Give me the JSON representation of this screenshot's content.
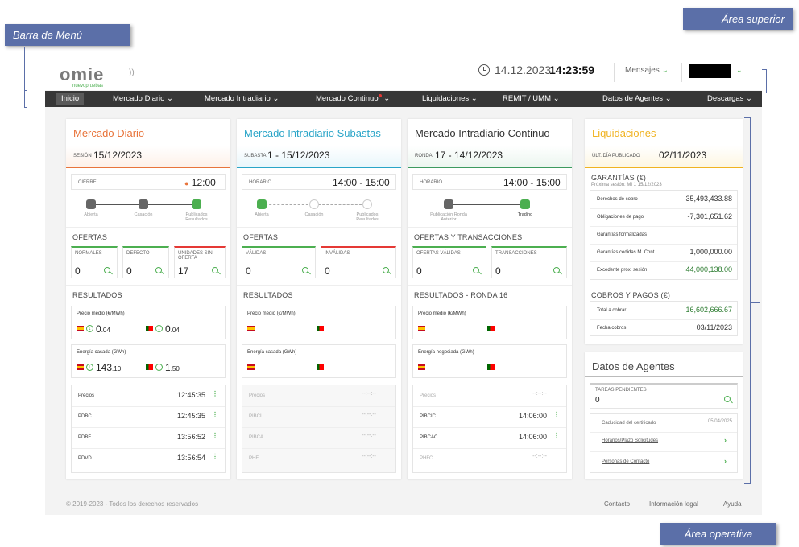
{
  "annotations": {
    "menu_bar": "Barra de Menú",
    "top_area": "Área superior",
    "operative_area": "Área operativa"
  },
  "header": {
    "logo_main": "omie",
    "logo_sub": "nuevopruebas",
    "date": "14.12.2023",
    "time": "14:23:59",
    "messages_label": "Mensajes",
    "user_name": ""
  },
  "nav": [
    "Inicio",
    "Mercado Diario",
    "Mercado Intradiario",
    "Mercado Continuo",
    "Liquidaciones",
    "REMIT / UMM",
    "Datos de Agentes",
    "Descargas"
  ],
  "diario": {
    "title": "Mercado Diario",
    "session_label": "SESIÓN",
    "session_value": "15/12/2023",
    "close_label": "CIERRE",
    "close_time": "12:00",
    "steps": [
      "Abierta",
      "Casación",
      "Publicados Resultados"
    ],
    "offers_title": "OFERTAS",
    "offers": [
      {
        "label": "NORMALES",
        "value": "0"
      },
      {
        "label": "DEFECTO",
        "value": "0"
      },
      {
        "label": "UNIDADES SIN OFERTA",
        "value": "17"
      }
    ],
    "results_title": "RESULTADOS",
    "price_label": "Precio medio (€/MWh)",
    "price_es_int": "0",
    "price_es_dec": ".04",
    "price_pt_int": "0",
    "price_pt_dec": ".04",
    "energy_label": "Energía casada (GWh)",
    "energy_es_int": "143",
    "energy_es_dec": ".10",
    "energy_pt_int": "1",
    "energy_pt_dec": ".50",
    "rows": [
      {
        "label": "Precios",
        "value": "12:45:35"
      },
      {
        "label": "PDBC",
        "value": "12:45:35"
      },
      {
        "label": "PDBF",
        "value": "13:56:52"
      },
      {
        "label": "PDVD",
        "value": "13:56:54"
      }
    ]
  },
  "subastas": {
    "title": "Mercado Intradiario Subastas",
    "session_label": "SUBASTA",
    "session_value": "1 - 15/12/2023",
    "schedule_label": "HORARIO",
    "schedule_value": "14:00 - 15:00",
    "steps": [
      "Abierta",
      "Casación",
      "Publicados Resultados"
    ],
    "offers_title": "OFERTAS",
    "offers": [
      {
        "label": "VÁLIDAS",
        "value": "0"
      },
      {
        "label": "INVÁLIDAS",
        "value": "0"
      }
    ],
    "results_title": "RESULTADOS",
    "price_label": "Precio medio (€/MWh)",
    "energy_label": "Energía casada (GWh)",
    "rows": [
      {
        "label": "Precios",
        "value": "--:--:--"
      },
      {
        "label": "PIBCI",
        "value": "--:--:--"
      },
      {
        "label": "PIBCA",
        "value": "--:--:--"
      },
      {
        "label": "PHF",
        "value": "--:--:--"
      }
    ]
  },
  "continuo": {
    "title": "Mercado Intradiario Continuo",
    "session_label": "RONDA",
    "session_value": "17 - 14/12/2023",
    "schedule_label": "HORARIO",
    "schedule_value": "14:00 - 15:00",
    "steps": [
      "Publicación Ronda Anterior",
      "Trading"
    ],
    "offers_title": "OFERTAS Y TRANSACCIONES",
    "offers": [
      {
        "label": "OFERTAS VÁLIDAS",
        "value": "0"
      },
      {
        "label": "TRANSACCIONES",
        "value": "0"
      }
    ],
    "results_title": "RESULTADOS - RONDA 16",
    "price_label": "Precio medio (€/MWh)",
    "energy_label": "Energía negociada (GWh)",
    "rows": [
      {
        "label": "Precios",
        "value": "--:--:--"
      },
      {
        "label": "PIBCIC",
        "value": "14:06:00"
      },
      {
        "label": "PIBCAC",
        "value": "14:06:00"
      },
      {
        "label": "PHFC",
        "value": "--:--:--"
      }
    ]
  },
  "liquidaciones": {
    "title": "Liquidaciones",
    "session_label": "ÚLT. DÍA PUBLICADO",
    "session_value": "02/11/2023",
    "guarantees_title": "GARANTÍAS (€)",
    "next_session": "Próxima sesión: MI 1 15/12/2023",
    "guarantees": [
      {
        "label": "Derechos de cobro",
        "value": "35,493,433.88"
      },
      {
        "label": "Obligaciones de pago",
        "value": "-7,301,651.62"
      },
      {
        "label": "Garantías formalizadas",
        "value": ""
      },
      {
        "label": "Garantías cedidas M. Cont",
        "value": "1,000,000.00"
      },
      {
        "label": "Excedente próx. sesión",
        "value": "44,000,138.00"
      }
    ],
    "payments_title": "COBROS Y PAGOS (€)",
    "payments": [
      {
        "label": "Total a cobrar",
        "value": "16,602,666.67"
      },
      {
        "label": "Fecha cobros",
        "value": "03/11/2023"
      }
    ]
  },
  "agentes": {
    "title": "Datos de Agentes",
    "tasks_label": "TAREAS PENDIENTES",
    "tasks_value": "0",
    "cert_label": "Caducidad del certificado",
    "cert_value": "05/04/2025",
    "links": [
      "Horarios/Plazo Solicitudes",
      "Personas de Contacto"
    ]
  },
  "footer": {
    "copyright": "© 2019-2023 - Todos los derechos reservados",
    "links": [
      "Contacto",
      "Información legal",
      "Ayuda"
    ]
  },
  "colors": {
    "diario": "#e8743b",
    "subastas": "#2aa5c8",
    "continuo": "#3c9a5f",
    "liquidaciones": "#f0b322",
    "accent": "#4caf50"
  }
}
